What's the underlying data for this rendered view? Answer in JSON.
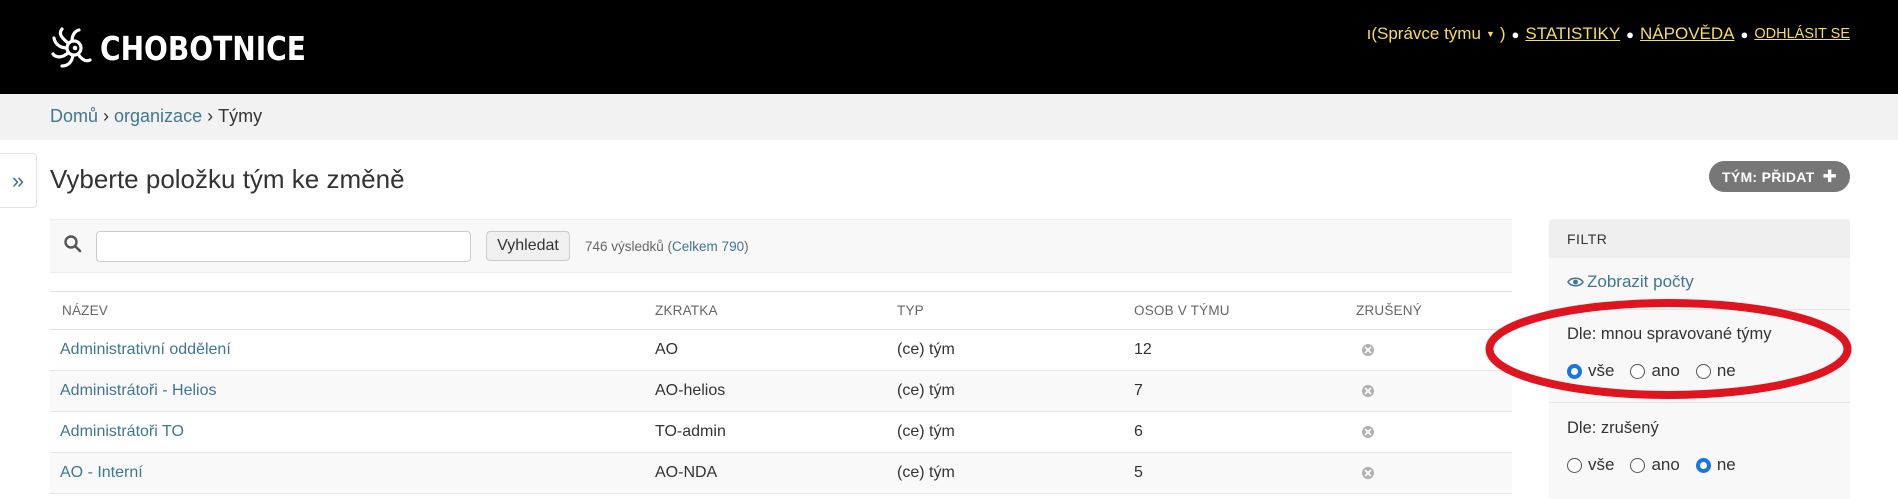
{
  "header": {
    "brand": "CHOBOTNICE",
    "user_partial": "ı",
    "role_open": "( ",
    "role": "Správce týmu",
    "role_close": " )",
    "links": [
      "STATISTIKY",
      "NÁPOVĚDA",
      "ODHLÁSIT SE"
    ]
  },
  "breadcrumbs": [
    "Domů",
    "organizace",
    "Týmy"
  ],
  "nav_toggle": "»",
  "page": {
    "title": "Vyberte položku tým ke změně",
    "add_label": "TÝM: PŘIDAT"
  },
  "search": {
    "value": "",
    "button": "Vyhledat",
    "result_text": "746 výsledků (",
    "total_link": "Celkem 790",
    "result_end": ")"
  },
  "table": {
    "headers": [
      "NÁZEV",
      "ZKRATKA",
      "TYP",
      "OSOB V TÝMU",
      "ZRUŠENÝ"
    ],
    "rows": [
      {
        "name": "Administrativní oddělení",
        "abbr": "AO",
        "type": "(ce) tým",
        "count": "12"
      },
      {
        "name": "Administrátoři - Helios",
        "abbr": "AO-helios",
        "type": "(ce) tým",
        "count": "7"
      },
      {
        "name": "Administrátoři TO",
        "abbr": "TO-admin",
        "type": "(ce) tým",
        "count": "6"
      },
      {
        "name": "AO - Interní",
        "abbr": "AO-NDA",
        "type": "(ce) tým",
        "count": "5"
      }
    ]
  },
  "filter": {
    "title": "FILTR",
    "show_counts": "Zobrazit počty",
    "groups": [
      {
        "title": "Dle: mnou spravované týmy",
        "options": [
          "vše",
          "ano",
          "ne"
        ],
        "selected": "vše"
      },
      {
        "title": "Dle: zrušený",
        "options": [
          "vše",
          "ano",
          "ne"
        ],
        "selected": "ne"
      }
    ]
  },
  "colors": {
    "header_bg": "#000000",
    "header_link": "#f5dd5d",
    "link": "#417690",
    "annotation": "#e0141e",
    "radio_checked": "#1a73e8"
  }
}
